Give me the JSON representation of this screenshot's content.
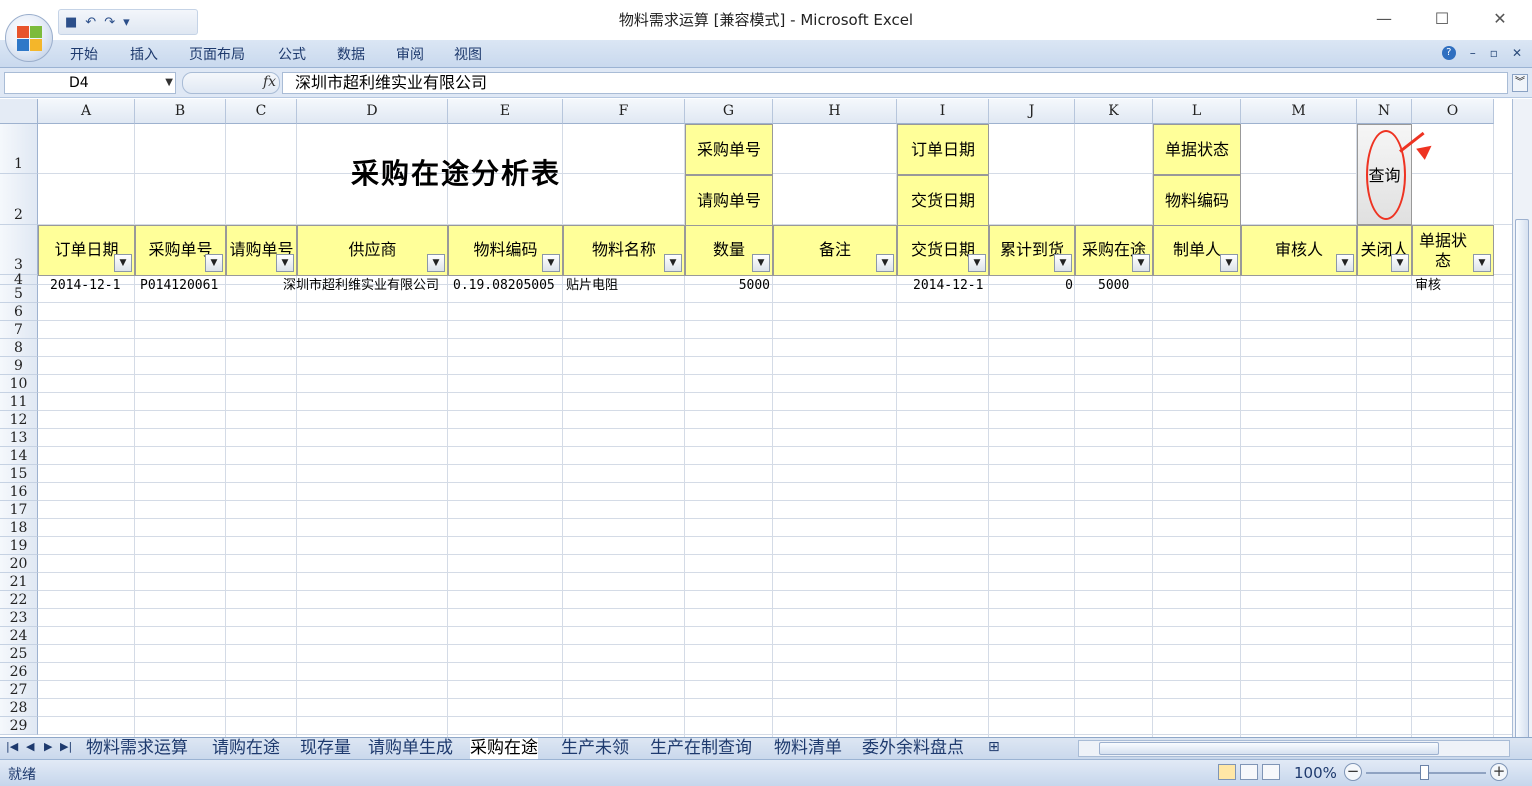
{
  "window": {
    "title": "物料需求运算  [兼容模式] - Microsoft Excel",
    "controls": {
      "minimize": "—",
      "maximize": "☐",
      "close": "✕"
    }
  },
  "qat": {
    "save_icon": "save-icon",
    "undo_icon": "undo-icon",
    "redo_icon": "redo-icon"
  },
  "ribbon": {
    "tabs": [
      "开始",
      "插入",
      "页面布局",
      "公式",
      "数据",
      "审阅",
      "视图"
    ],
    "help": "?",
    "min": "–",
    "restore": "▫",
    "close": "✕"
  },
  "formula_bar": {
    "name_box": "D4",
    "fx": "fx",
    "content": "深圳市超利维实业有限公司"
  },
  "columns": [
    "A",
    "B",
    "C",
    "D",
    "E",
    "F",
    "G",
    "H",
    "I",
    "J",
    "K",
    "L",
    "M",
    "N",
    "O"
  ],
  "rows": [
    "1",
    "2",
    "3",
    "4",
    "5",
    "6",
    "7",
    "8",
    "9",
    "10",
    "11",
    "12",
    "13",
    "14",
    "15",
    "16",
    "17",
    "18",
    "19",
    "20",
    "21",
    "22",
    "23",
    "24",
    "25",
    "26",
    "27",
    "28",
    "29"
  ],
  "sheet": {
    "title": "采购在途分析表",
    "filters": {
      "purchase_no_label": "采购单号",
      "request_no_label": "请购单号",
      "order_date_label": "订单日期",
      "delivery_date_label": "交货日期",
      "doc_status_label": "单据状态",
      "material_code_label": "物料编码",
      "query_button": "查询"
    },
    "headers": [
      "订单日期",
      "采购单号",
      "请购单号",
      "供应商",
      "物料编码",
      "物料名称",
      "数量",
      "备注",
      "交货日期",
      "累计到货",
      "采购在途",
      "制单人",
      "审核人",
      "关闭人",
      "单据状态"
    ],
    "row4": {
      "order_date": "2014-12-1",
      "purchase_no": "P014120061",
      "request_no": "",
      "supplier": "深圳市超利维实业有限公司",
      "material_code": "0.19.08205005",
      "material_name": "贴片电阻",
      "qty": "5000",
      "remark": "",
      "delivery_date": "2014-12-1",
      "received": "0",
      "in_transit": "5000",
      "creator": "",
      "auditor": "",
      "closer": "",
      "status": "审核"
    }
  },
  "sheet_tabs": [
    "物料需求运算",
    "请购在途",
    "现存量",
    "请购单生成",
    "采购在途",
    "生产未领",
    "生产在制查询",
    "物料清单",
    "委外余料盘点"
  ],
  "active_sheet": "采购在途",
  "status": {
    "ready": "就绪",
    "zoom": "100%"
  }
}
